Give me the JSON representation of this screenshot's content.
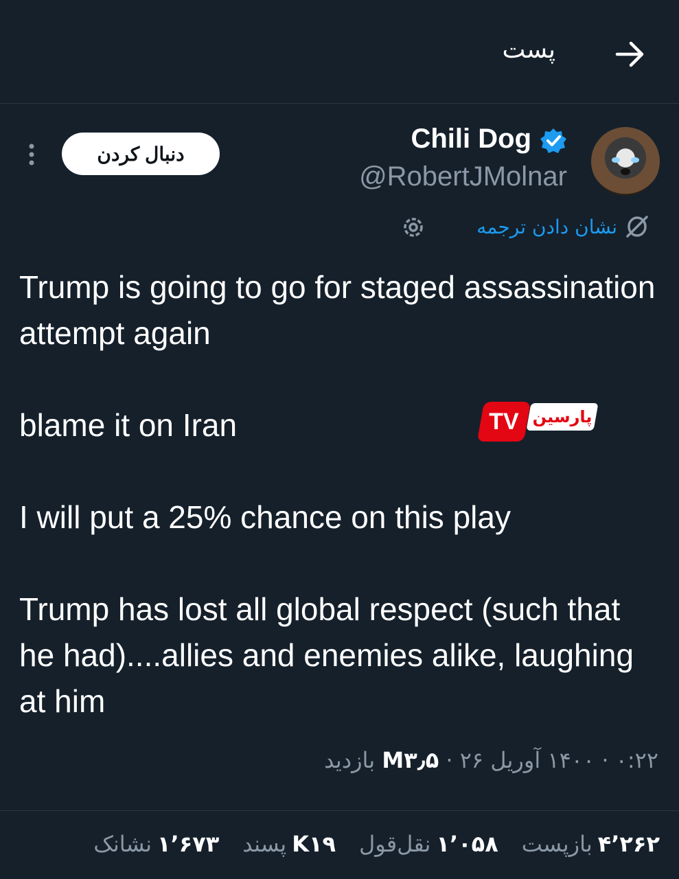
{
  "header": {
    "title": "پست",
    "back_icon": "arrow-right-icon"
  },
  "author": {
    "display_name": "Chili Dog",
    "handle": "@RobertJMolnar",
    "verified_color": "#1d9bf0"
  },
  "follow_label": "دنبال کردن",
  "translate_label": "نشان دادن ترجمه",
  "tweet": {
    "paragraphs": [
      "Trump is going to go for staged assassination attempt again",
      "blame it on Iran",
      "I will put a 25% chance on this play",
      "Trump has lost all global respect (such that he had)....allies and enemies alike, laughing at him"
    ]
  },
  "watermark": {
    "tv": "TV",
    "word": "پارسین"
  },
  "meta": {
    "time": "۰:۲۲",
    "sep1": "·",
    "date": "۱۴۰۰ آوریل ۲۶",
    "sep2": "·",
    "views_count": "M۳٫۵",
    "views_label": "بازدید"
  },
  "stats": [
    {
      "num": "۴٬۲۶۲",
      "label": "بازپست"
    },
    {
      "num": "۱٬۰۵۸",
      "label": "نقل‌قول"
    },
    {
      "num": "K۱۹",
      "label": "پسند"
    },
    {
      "num": "۱٬۶۷۳",
      "label": "نشانک"
    }
  ],
  "colors": {
    "background": "#15202b",
    "accent": "#1d9bf0",
    "muted": "#8b98a5"
  }
}
